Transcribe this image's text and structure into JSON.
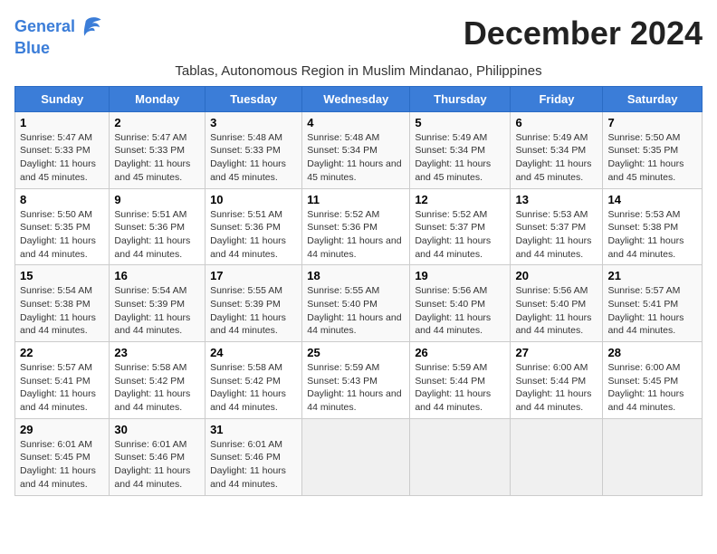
{
  "logo": {
    "line1": "General",
    "line2": "Blue"
  },
  "title": "December 2024",
  "subtitle": "Tablas, Autonomous Region in Muslim Mindanao, Philippines",
  "days_header": [
    "Sunday",
    "Monday",
    "Tuesday",
    "Wednesday",
    "Thursday",
    "Friday",
    "Saturday"
  ],
  "weeks": [
    [
      {
        "day": "1",
        "sunrise": "5:47 AM",
        "sunset": "5:33 PM",
        "daylight": "11 hours and 45 minutes."
      },
      {
        "day": "2",
        "sunrise": "5:47 AM",
        "sunset": "5:33 PM",
        "daylight": "11 hours and 45 minutes."
      },
      {
        "day": "3",
        "sunrise": "5:48 AM",
        "sunset": "5:33 PM",
        "daylight": "11 hours and 45 minutes."
      },
      {
        "day": "4",
        "sunrise": "5:48 AM",
        "sunset": "5:34 PM",
        "daylight": "11 hours and 45 minutes."
      },
      {
        "day": "5",
        "sunrise": "5:49 AM",
        "sunset": "5:34 PM",
        "daylight": "11 hours and 45 minutes."
      },
      {
        "day": "6",
        "sunrise": "5:49 AM",
        "sunset": "5:34 PM",
        "daylight": "11 hours and 45 minutes."
      },
      {
        "day": "7",
        "sunrise": "5:50 AM",
        "sunset": "5:35 PM",
        "daylight": "11 hours and 45 minutes."
      }
    ],
    [
      {
        "day": "8",
        "sunrise": "5:50 AM",
        "sunset": "5:35 PM",
        "daylight": "11 hours and 44 minutes."
      },
      {
        "day": "9",
        "sunrise": "5:51 AM",
        "sunset": "5:36 PM",
        "daylight": "11 hours and 44 minutes."
      },
      {
        "day": "10",
        "sunrise": "5:51 AM",
        "sunset": "5:36 PM",
        "daylight": "11 hours and 44 minutes."
      },
      {
        "day": "11",
        "sunrise": "5:52 AM",
        "sunset": "5:36 PM",
        "daylight": "11 hours and 44 minutes."
      },
      {
        "day": "12",
        "sunrise": "5:52 AM",
        "sunset": "5:37 PM",
        "daylight": "11 hours and 44 minutes."
      },
      {
        "day": "13",
        "sunrise": "5:53 AM",
        "sunset": "5:37 PM",
        "daylight": "11 hours and 44 minutes."
      },
      {
        "day": "14",
        "sunrise": "5:53 AM",
        "sunset": "5:38 PM",
        "daylight": "11 hours and 44 minutes."
      }
    ],
    [
      {
        "day": "15",
        "sunrise": "5:54 AM",
        "sunset": "5:38 PM",
        "daylight": "11 hours and 44 minutes."
      },
      {
        "day": "16",
        "sunrise": "5:54 AM",
        "sunset": "5:39 PM",
        "daylight": "11 hours and 44 minutes."
      },
      {
        "day": "17",
        "sunrise": "5:55 AM",
        "sunset": "5:39 PM",
        "daylight": "11 hours and 44 minutes."
      },
      {
        "day": "18",
        "sunrise": "5:55 AM",
        "sunset": "5:40 PM",
        "daylight": "11 hours and 44 minutes."
      },
      {
        "day": "19",
        "sunrise": "5:56 AM",
        "sunset": "5:40 PM",
        "daylight": "11 hours and 44 minutes."
      },
      {
        "day": "20",
        "sunrise": "5:56 AM",
        "sunset": "5:40 PM",
        "daylight": "11 hours and 44 minutes."
      },
      {
        "day": "21",
        "sunrise": "5:57 AM",
        "sunset": "5:41 PM",
        "daylight": "11 hours and 44 minutes."
      }
    ],
    [
      {
        "day": "22",
        "sunrise": "5:57 AM",
        "sunset": "5:41 PM",
        "daylight": "11 hours and 44 minutes."
      },
      {
        "day": "23",
        "sunrise": "5:58 AM",
        "sunset": "5:42 PM",
        "daylight": "11 hours and 44 minutes."
      },
      {
        "day": "24",
        "sunrise": "5:58 AM",
        "sunset": "5:42 PM",
        "daylight": "11 hours and 44 minutes."
      },
      {
        "day": "25",
        "sunrise": "5:59 AM",
        "sunset": "5:43 PM",
        "daylight": "11 hours and 44 minutes."
      },
      {
        "day": "26",
        "sunrise": "5:59 AM",
        "sunset": "5:44 PM",
        "daylight": "11 hours and 44 minutes."
      },
      {
        "day": "27",
        "sunrise": "6:00 AM",
        "sunset": "5:44 PM",
        "daylight": "11 hours and 44 minutes."
      },
      {
        "day": "28",
        "sunrise": "6:00 AM",
        "sunset": "5:45 PM",
        "daylight": "11 hours and 44 minutes."
      }
    ],
    [
      {
        "day": "29",
        "sunrise": "6:01 AM",
        "sunset": "5:45 PM",
        "daylight": "11 hours and 44 minutes."
      },
      {
        "day": "30",
        "sunrise": "6:01 AM",
        "sunset": "5:46 PM",
        "daylight": "11 hours and 44 minutes."
      },
      {
        "day": "31",
        "sunrise": "6:01 AM",
        "sunset": "5:46 PM",
        "daylight": "11 hours and 44 minutes."
      },
      null,
      null,
      null,
      null
    ]
  ],
  "labels": {
    "sunrise": "Sunrise:",
    "sunset": "Sunset:",
    "daylight": "Daylight:"
  }
}
